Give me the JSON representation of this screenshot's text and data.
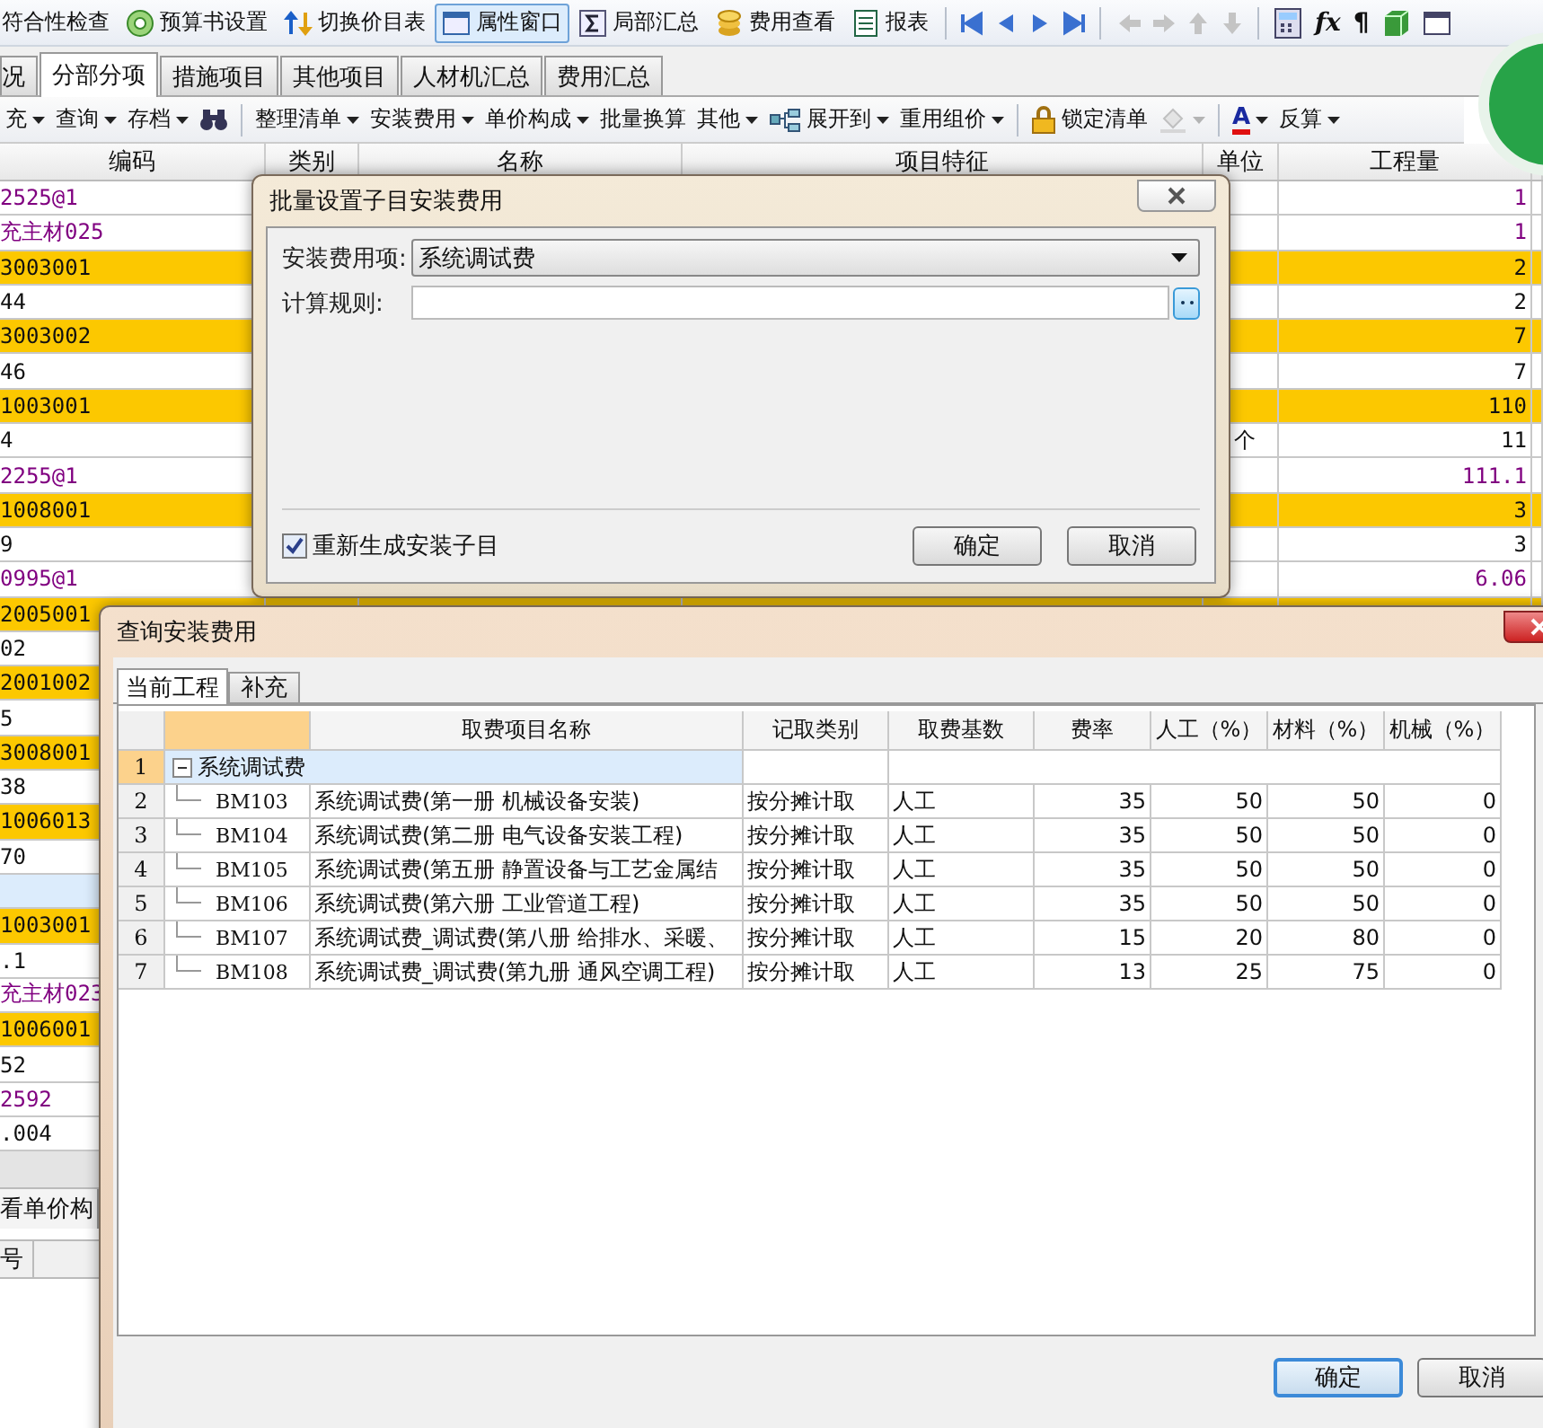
{
  "toolbar": [
    {
      "label": "符合性检查",
      "selected": false
    },
    {
      "label": "预算书设置",
      "selected": false
    },
    {
      "label": "切换价目表",
      "selected": false
    },
    {
      "label": "属性窗口",
      "selected": true
    },
    {
      "label": "局部汇总",
      "selected": false
    },
    {
      "label": "费用查看",
      "selected": false
    },
    {
      "label": "报表",
      "selected": false
    }
  ],
  "nav_buttons": [
    {
      "disabled": false
    },
    {
      "disabled": false
    },
    {
      "disabled": false
    },
    {
      "disabled": false
    },
    {
      "disabled": true
    },
    {
      "disabled": true
    },
    {
      "disabled": true
    },
    {
      "disabled": true
    }
  ],
  "tool_glyphs": [
    "fx",
    "¶"
  ],
  "tabs": [
    {
      "label": "况",
      "selected": false
    },
    {
      "label": "分部分项",
      "selected": true
    },
    {
      "label": "措施项目",
      "selected": false
    },
    {
      "label": "其他项目",
      "selected": false
    },
    {
      "label": "人材机汇总",
      "selected": false
    },
    {
      "label": "费用汇总",
      "selected": false
    }
  ],
  "toolbar2": [
    {
      "kind": "menu",
      "label": "充",
      "dropdown": true
    },
    {
      "kind": "menu",
      "label": "查询",
      "dropdown": true
    },
    {
      "kind": "menu",
      "label": "存档",
      "dropdown": true
    },
    {
      "kind": "icon",
      "dropdown": false
    },
    {
      "kind": "separator"
    },
    {
      "kind": "menu",
      "label": "整理清单",
      "dropdown": true
    },
    {
      "kind": "menu",
      "label": "安装费用",
      "dropdown": true
    },
    {
      "kind": "menu",
      "label": "单价构成",
      "dropdown": true
    },
    {
      "kind": "menu",
      "label": "批量换算",
      "dropdown": false
    },
    {
      "kind": "menu",
      "label": "其他",
      "dropdown": true
    },
    {
      "kind": "menu",
      "label": "展开到",
      "dropdown": true
    },
    {
      "kind": "menu",
      "label": "重用组价",
      "dropdown": true
    },
    {
      "kind": "separator"
    },
    {
      "kind": "menu",
      "label": "锁定清单",
      "dropdown": false
    },
    {
      "kind": "icon",
      "dropdown": true,
      "disabled": true
    },
    {
      "kind": "separator"
    },
    {
      "kind": "fontcolor",
      "label": "A",
      "dropdown": true
    },
    {
      "kind": "menu",
      "label": "反算",
      "dropdown": true
    }
  ],
  "table": {
    "columns": [
      "编码",
      "类别",
      "名称",
      "项目特征",
      "单位",
      "工程量"
    ],
    "rows": [
      {
        "code": "2525@1",
        "kind": "material",
        "qty": "1",
        "selected": false
      },
      {
        "code": "充主材025",
        "kind": "material",
        "qty": "1",
        "selected": false
      },
      {
        "code": "3003001",
        "kind": "list",
        "qty": "2",
        "selected": false
      },
      {
        "code": "44",
        "kind": "quota",
        "qty": "2",
        "selected": false
      },
      {
        "code": "3003002",
        "kind": "list",
        "qty": "7",
        "selected": false
      },
      {
        "code": "46",
        "kind": "quota",
        "qty": "7",
        "selected": false
      },
      {
        "code": "1003001",
        "kind": "list",
        "qty": "110",
        "selected": false
      },
      {
        "code": "4",
        "kind": "quota",
        "unit": "个",
        "qty": "11",
        "selected": false
      },
      {
        "code": "2255@1",
        "kind": "material",
        "qty": "111.1",
        "selected": false
      },
      {
        "code": "1008001",
        "kind": "list",
        "qty": "3",
        "selected": false
      },
      {
        "code": "9",
        "kind": "quota",
        "qty": "3",
        "selected": false
      },
      {
        "code": "0995@1",
        "kind": "material",
        "qty": "6.06",
        "selected": false
      },
      {
        "code": "2005001",
        "kind": "list",
        "selected": false
      },
      {
        "code": "02",
        "kind": "quota",
        "selected": false
      },
      {
        "code": "2001002",
        "kind": "list",
        "selected": false
      },
      {
        "code": "5",
        "kind": "quota",
        "selected": false
      },
      {
        "code": "3008001",
        "kind": "list",
        "selected": false
      },
      {
        "code": "38",
        "kind": "quota",
        "selected": false
      },
      {
        "code": "1006013",
        "kind": "list",
        "selected": false
      },
      {
        "code": "70",
        "kind": "quota",
        "selected": false
      },
      {
        "kind": "quota",
        "selected": true
      },
      {
        "code": "1003001",
        "kind": "list",
        "selected": false
      },
      {
        "code": ".1",
        "kind": "quota",
        "selected": false
      },
      {
        "code": "充主材023",
        "kind": "material",
        "selected": false
      },
      {
        "code": "1006001",
        "kind": "list",
        "selected": false
      },
      {
        "code": "52",
        "kind": "quota",
        "selected": false
      },
      {
        "code": "2592",
        "kind": "material",
        "selected": false
      },
      {
        "code": ".004",
        "kind": "quota",
        "selected": false
      }
    ]
  },
  "bottom_panel": {
    "tab": "看单价构",
    "column": "号"
  },
  "dialog1": {
    "title": "批量设置子目安装费用",
    "fee_item": {
      "label": "安装费用项:",
      "value": "系统调试费"
    },
    "rule": {
      "label": "计算规则:"
    },
    "checkbox": {
      "label": "重新生成安装子目",
      "checked": true
    },
    "buttons": [
      {
        "label": "确定",
        "focused": false
      },
      {
        "label": "取消",
        "focused": false
      }
    ]
  },
  "dialog2": {
    "title": "查询安装费用",
    "tabs": [
      {
        "label": "当前工程",
        "selected": true
      },
      {
        "label": "补充",
        "selected": false
      }
    ],
    "columns": [
      "取费项目名称",
      "记取类别",
      "取费基数",
      "费率",
      "人工（%）",
      "材料（%）",
      "机械（%）"
    ],
    "tree": [
      {
        "num": "1",
        "name": "系统调试费",
        "expanded": true,
        "selected": true,
        "children": [
          {
            "num": "2",
            "code": "BM103",
            "name": "系统调试费(第一册 机械设备安装)",
            "category": "按分摊计取",
            "base": "人工",
            "rate": "35",
            "labor": "50",
            "material": "50",
            "machine": "0",
            "selected": false
          },
          {
            "num": "3",
            "code": "BM104",
            "name": "系统调试费(第二册 电气设备安装工程)",
            "category": "按分摊计取",
            "base": "人工",
            "rate": "35",
            "labor": "50",
            "material": "50",
            "machine": "0",
            "selected": false
          },
          {
            "num": "4",
            "code": "BM105",
            "name": "系统调试费(第五册 静置设备与工艺金属结",
            "category": "按分摊计取",
            "base": "人工",
            "rate": "35",
            "labor": "50",
            "material": "50",
            "machine": "0",
            "selected": false
          },
          {
            "num": "5",
            "code": "BM106",
            "name": "系统调试费(第六册 工业管道工程)",
            "category": "按分摊计取",
            "base": "人工",
            "rate": "35",
            "labor": "50",
            "material": "50",
            "machine": "0",
            "selected": false
          },
          {
            "num": "6",
            "code": "BM107",
            "name": "系统调试费_调试费(第八册 给排水、采暖、",
            "category": "按分摊计取",
            "base": "人工",
            "rate": "15",
            "labor": "20",
            "material": "80",
            "machine": "0",
            "selected": false
          },
          {
            "num": "7",
            "code": "BM108",
            "name": "系统调试费_调试费(第九册 通风空调工程)",
            "category": "按分摊计取",
            "base": "人工",
            "rate": "13",
            "labor": "25",
            "material": "75",
            "machine": "0",
            "selected": false
          }
        ]
      }
    ],
    "buttons": [
      {
        "label": "确定",
        "focused": true
      },
      {
        "label": "取消",
        "focused": false
      }
    ]
  }
}
